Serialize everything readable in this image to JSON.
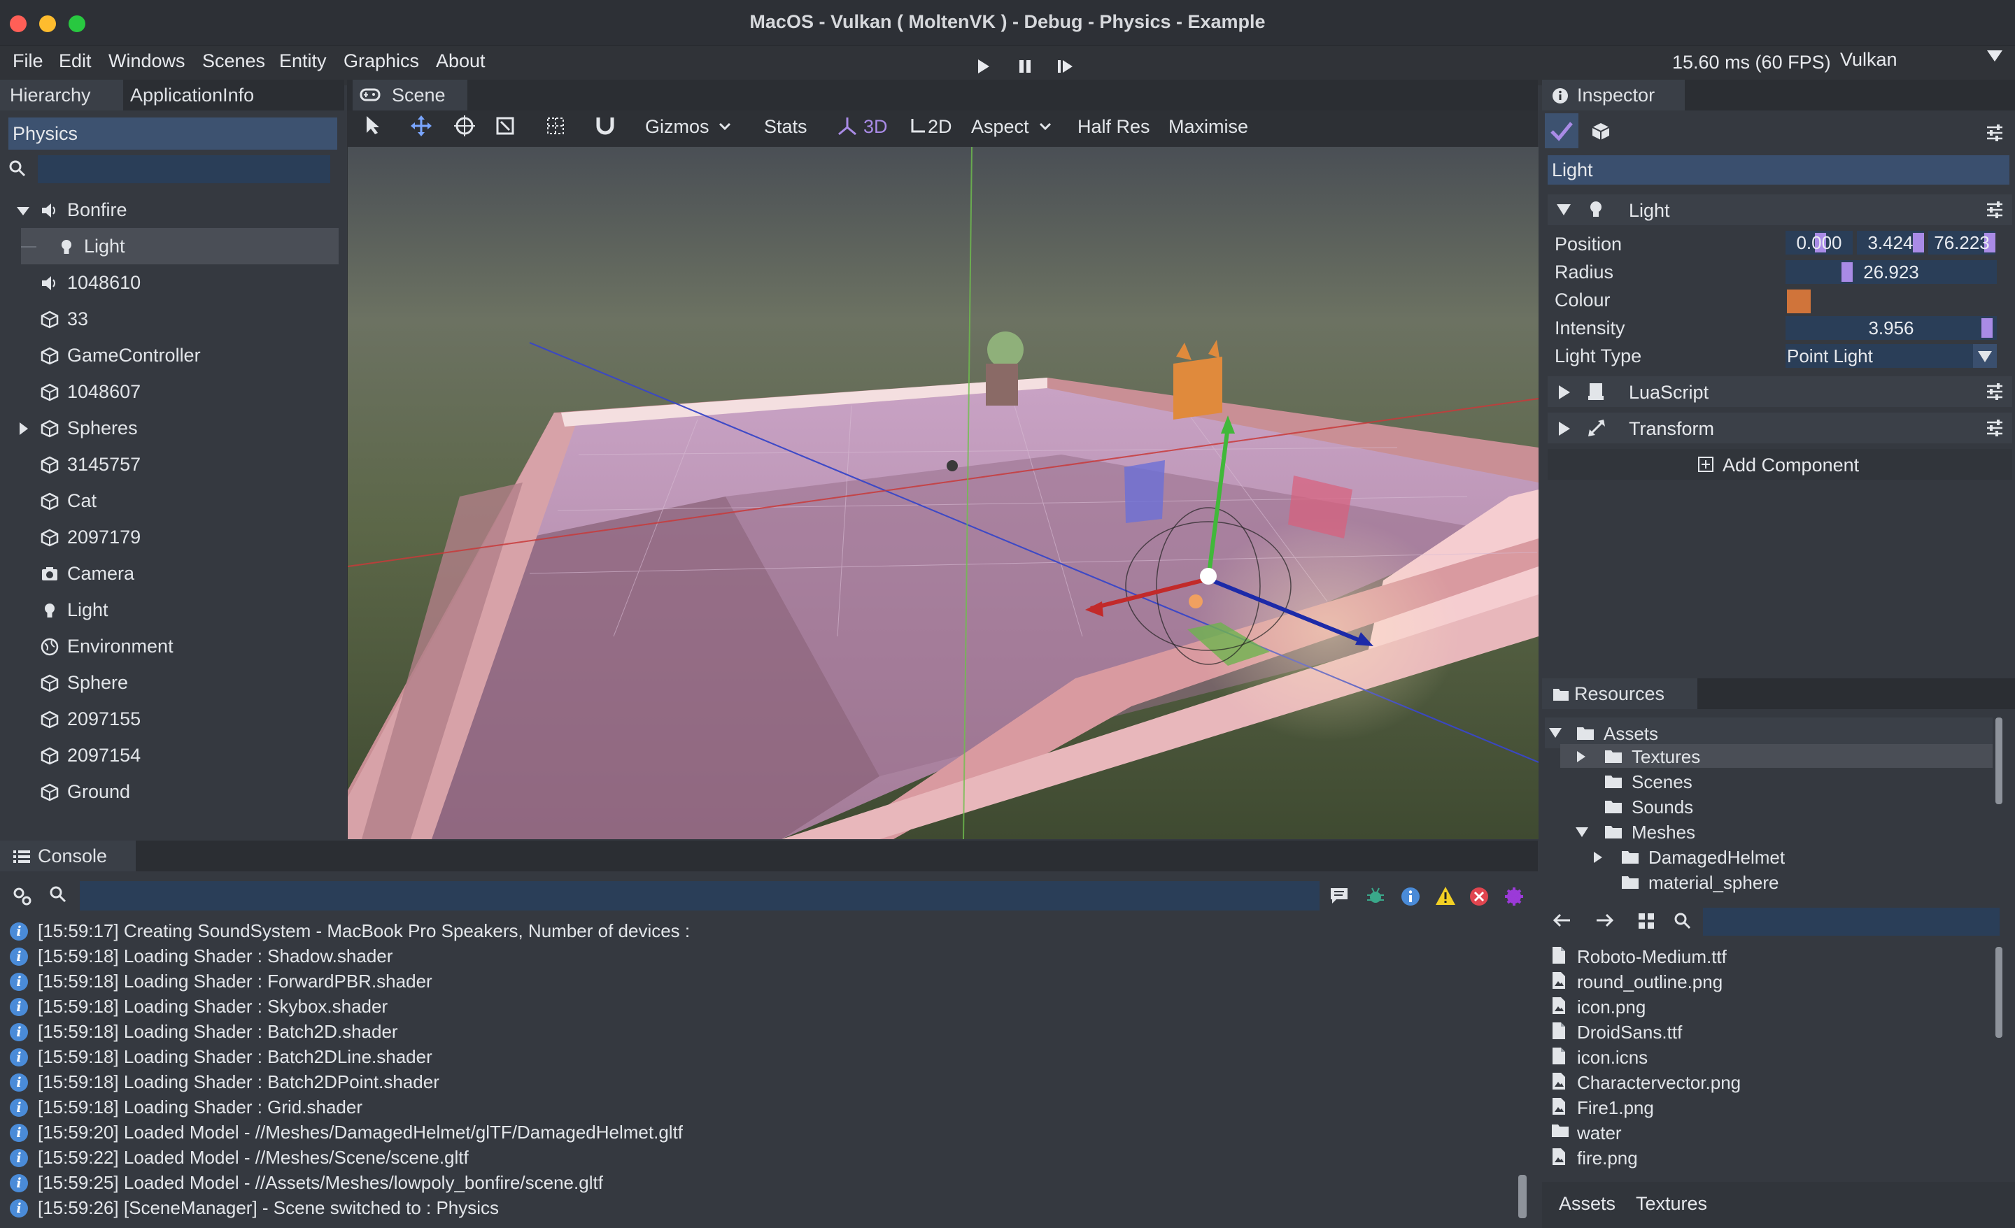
{
  "window": {
    "title": "MacOS - Vulkan ( MoltenVK ) - Debug - Physics - Example",
    "traffic_colors": [
      "#ff5f57",
      "#febc2e",
      "#28c840"
    ]
  },
  "menu": {
    "items": [
      "File",
      "Edit",
      "Windows",
      "Scenes",
      "Entity",
      "Graphics",
      "About"
    ],
    "fps": "15.60 ms (60 FPS)",
    "renderer": "Vulkan"
  },
  "hierarchy": {
    "tabs": [
      "Hierarchy",
      "ApplicationInfo"
    ],
    "scene_name": "Physics",
    "search_value": "",
    "items": [
      {
        "label": "Bonfire",
        "icon": "speaker-icon",
        "expander": "down",
        "indent": 0
      },
      {
        "label": "Light",
        "icon": "lightbulb-icon",
        "expander": "",
        "indent": 1,
        "selected": true
      },
      {
        "label": "1048610",
        "icon": "speaker-icon",
        "expander": "",
        "indent": 0
      },
      {
        "label": "33",
        "icon": "cube-icon",
        "expander": "",
        "indent": 0
      },
      {
        "label": "GameController",
        "icon": "cube-icon",
        "expander": "",
        "indent": 0
      },
      {
        "label": "1048607",
        "icon": "cube-icon",
        "expander": "",
        "indent": 0
      },
      {
        "label": "Spheres",
        "icon": "cube-icon",
        "expander": "right",
        "indent": 0
      },
      {
        "label": "3145757",
        "icon": "cube-icon",
        "expander": "",
        "indent": 0
      },
      {
        "label": "Cat",
        "icon": "cube-icon",
        "expander": "",
        "indent": 0
      },
      {
        "label": "2097179",
        "icon": "cube-icon",
        "expander": "",
        "indent": 0
      },
      {
        "label": "Camera",
        "icon": "camera-icon",
        "expander": "",
        "indent": 0
      },
      {
        "label": "Light",
        "icon": "lightbulb-icon",
        "expander": "",
        "indent": 0
      },
      {
        "label": "Environment",
        "icon": "globe-icon",
        "expander": "",
        "indent": 0
      },
      {
        "label": "Sphere",
        "icon": "cube-icon",
        "expander": "",
        "indent": 0
      },
      {
        "label": "2097155",
        "icon": "cube-icon",
        "expander": "",
        "indent": 0
      },
      {
        "label": "2097154",
        "icon": "cube-icon",
        "expander": "",
        "indent": 0
      },
      {
        "label": "Ground",
        "icon": "cube-icon",
        "expander": "",
        "indent": 0
      }
    ]
  },
  "scene": {
    "tab": "Scene",
    "toolbar": {
      "gizmos": "Gizmos",
      "stats": "Stats",
      "mode3d": "3D",
      "mode2d": "2D",
      "aspect": "Aspect",
      "half_res": "Half Res",
      "maximise": "Maximise"
    }
  },
  "inspector": {
    "tab": "Inspector",
    "entity_name": "Light",
    "component_light": "Light",
    "labels": {
      "position": "Position",
      "radius": "Radius",
      "colour": "Colour",
      "intensity": "Intensity",
      "light_type": "Light Type"
    },
    "position": [
      "0.000",
      "3.424",
      "76.223"
    ],
    "radius": "26.923",
    "colour": "#d0743a",
    "intensity": "3.956",
    "light_type": "Point Light",
    "component_lua": "LuaScript",
    "component_transform": "Transform",
    "add_component": "Add Component"
  },
  "resources": {
    "tab": "Resources",
    "tree": [
      {
        "label": "Assets",
        "expander": "down",
        "level": 0
      },
      {
        "label": "Textures",
        "expander": "right",
        "level": 1,
        "selected": true
      },
      {
        "label": "Scenes",
        "expander": "",
        "level": 1
      },
      {
        "label": "Sounds",
        "expander": "",
        "level": 1
      },
      {
        "label": "Meshes",
        "expander": "down",
        "level": 1
      },
      {
        "label": "DamagedHelmet",
        "expander": "right",
        "level": 2
      },
      {
        "label": "material_sphere",
        "expander": "",
        "level": 2
      }
    ],
    "search_value": "",
    "files": [
      {
        "label": "Roboto-Medium.ttf",
        "icon": "file-icon"
      },
      {
        "label": "round_outline.png",
        "icon": "image-file-icon"
      },
      {
        "label": "icon.png",
        "icon": "image-file-icon"
      },
      {
        "label": "DroidSans.ttf",
        "icon": "file-icon"
      },
      {
        "label": "icon.icns",
        "icon": "file-icon"
      },
      {
        "label": "Charactervector.png",
        "icon": "image-file-icon"
      },
      {
        "label": "Fire1.png",
        "icon": "image-file-icon"
      },
      {
        "label": "water",
        "icon": "folder-icon"
      },
      {
        "label": "fire.png",
        "icon": "image-file-icon"
      }
    ],
    "breadcrumb": [
      "Assets",
      "Textures"
    ]
  },
  "console": {
    "tab": "Console",
    "filter_value": "",
    "lines": [
      "[15:59:17] Creating SoundSystem - MacBook Pro Speakers, Number of devices :",
      "[15:59:18] Loading Shader : Shadow.shader",
      "[15:59:18] Loading Shader : ForwardPBR.shader",
      "[15:59:18] Loading Shader : Skybox.shader",
      "[15:59:18] Loading Shader : Batch2D.shader",
      "[15:59:18] Loading Shader : Batch2DLine.shader",
      "[15:59:18] Loading Shader : Batch2DPoint.shader",
      "[15:59:18] Loading Shader : Grid.shader",
      "[15:59:20] Loaded Model - //Meshes/DamagedHelmet/glTF/DamagedHelmet.gltf",
      "[15:59:22] Loaded Model - //Meshes/Scene/scene.gltf",
      "[15:59:25] Loaded Model - //Assets/Meshes/lowpoly_bonfire/scene.gltf",
      "[15:59:26] [SceneManager] - Scene switched to : Physics"
    ]
  },
  "colors": {
    "accent": "#a98be6",
    "selection": "#3d5270",
    "field": "#2a3e58",
    "info": "#4a8bd8",
    "warning": "#f2d024",
    "error": "#e0454f"
  }
}
